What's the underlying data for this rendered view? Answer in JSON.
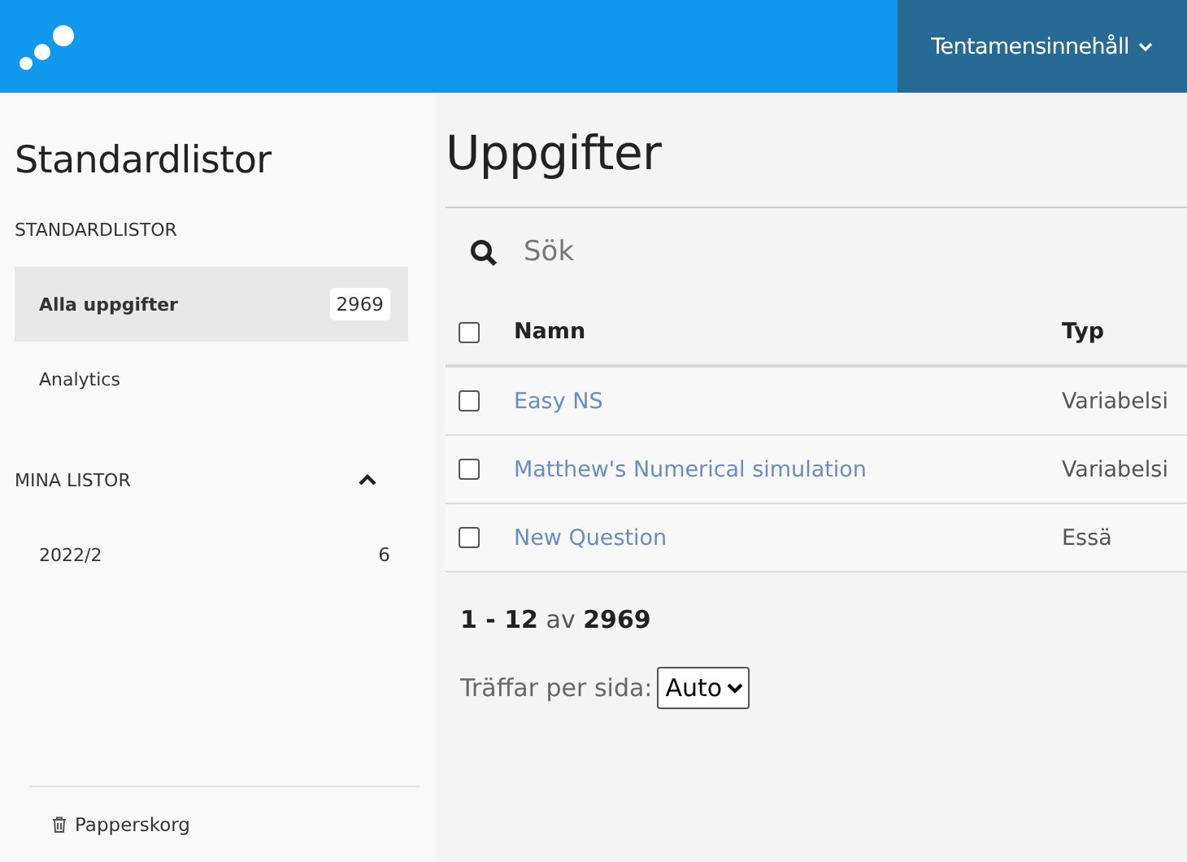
{
  "topbar": {
    "menu": {
      "label": "Tentamensinnehåll",
      "expanded": false
    }
  },
  "sidebar": {
    "title": "Standardlistor",
    "sections": [
      {
        "heading": "STANDARDLISTOR",
        "kind": "fixed",
        "items": [
          {
            "label": "Alla uppgifter",
            "count": "2969",
            "selected": true
          },
          {
            "label": "Analytics",
            "selected": false
          }
        ]
      },
      {
        "heading": "MINA LISTOR",
        "kind": "collapsible",
        "expanded": true,
        "items": [
          {
            "label": "2022/2",
            "count": "6",
            "selected": false
          }
        ]
      }
    ],
    "trash": "Papperskorg"
  },
  "main": {
    "title": "Uppgifter",
    "search": {
      "placeholder": "Sök"
    },
    "table": {
      "select_all_checked": false,
      "columns": [
        "Namn",
        "Typ"
      ],
      "rows": [
        {
          "checked": false,
          "name": "Easy NS",
          "type": "Variabelsi"
        },
        {
          "checked": false,
          "name": "Matthew's Numerical simulation",
          "type": "Variabelsi"
        },
        {
          "checked": false,
          "name": "New Question",
          "type": "Essä"
        }
      ]
    },
    "paging": "**1 - 12** av **2969**",
    "per_page": {
      "label": "Träffar per sida:",
      "value": "Auto"
    }
  }
}
